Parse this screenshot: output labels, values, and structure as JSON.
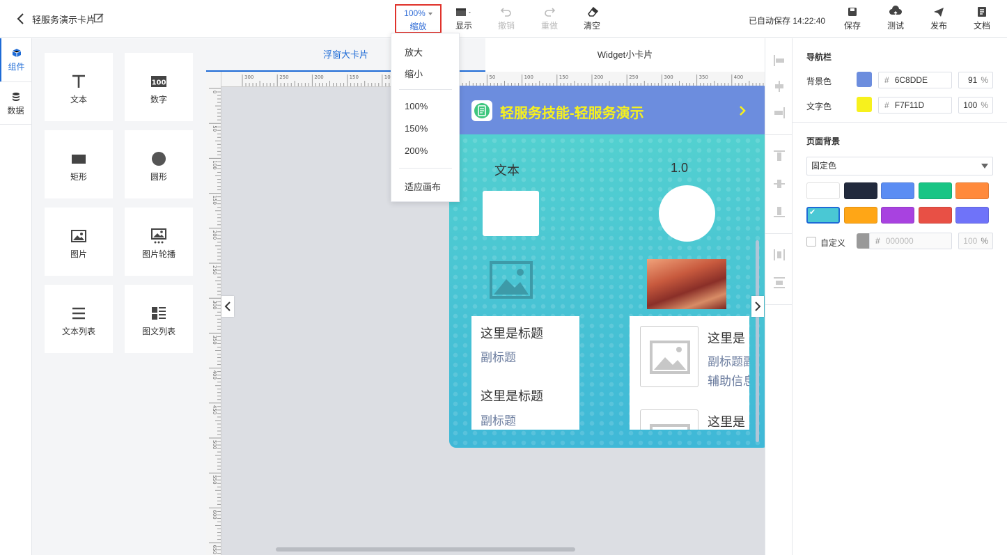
{
  "header": {
    "title": "轻服务演示卡片",
    "zoom": {
      "value": "100%",
      "label": "缩放"
    },
    "tools": {
      "display": "显示",
      "undo": "撤销",
      "redo": "重做",
      "clear": "清空"
    },
    "autosave": "已自动保存 14:22:40",
    "actions": {
      "save": "保存",
      "test": "测试",
      "publish": "发布",
      "docs": "文档"
    }
  },
  "rail": {
    "components": "组件",
    "data": "数据"
  },
  "palette": {
    "items": [
      {
        "label": "文本",
        "icon": "text-icon"
      },
      {
        "label": "数字",
        "icon": "number-icon"
      },
      {
        "label": "矩形",
        "icon": "rectangle-icon"
      },
      {
        "label": "圆形",
        "icon": "circle-icon"
      },
      {
        "label": "图片",
        "icon": "image-icon"
      },
      {
        "label": "图片轮播",
        "icon": "carousel-icon"
      },
      {
        "label": "文本列表",
        "icon": "text-list-icon"
      },
      {
        "label": "图文列表",
        "icon": "image-text-list-icon"
      }
    ]
  },
  "canvas": {
    "tabs": [
      {
        "label": "浮窗大卡片",
        "active": true
      },
      {
        "label": "Widget小卡片",
        "active": false
      }
    ],
    "ruler_h": [
      "300",
      "250",
      "200",
      "150",
      "100",
      "50",
      "0",
      "50",
      "100",
      "150",
      "200",
      "250",
      "300",
      "350",
      "400",
      "450"
    ],
    "ruler_v": [
      "0",
      "50",
      "100",
      "150",
      "200",
      "250",
      "300",
      "350",
      "400",
      "450",
      "500",
      "550",
      "600",
      "650"
    ]
  },
  "card": {
    "title": "轻服务技能-轻服务演示",
    "text": "文本",
    "number": "1.0",
    "list": [
      {
        "title": "这里是标题",
        "subtitle": "副标题"
      },
      {
        "title": "这里是标题",
        "subtitle": "副标题"
      }
    ],
    "rich": [
      {
        "title": "这里是",
        "subtitle": "副标题副",
        "aux": "辅助信息"
      },
      {
        "title": "这里是"
      }
    ]
  },
  "zoom_menu": {
    "items": [
      "放大",
      "缩小",
      "100%",
      "150%",
      "200%",
      "适应画布"
    ]
  },
  "props": {
    "navbar": {
      "title": "导航栏",
      "bg_label": "背景色",
      "bg_color": "6C8DDE",
      "bg_opacity": "91",
      "text_label": "文字色",
      "text_color": "F7F11D",
      "text_opacity": "100",
      "pct_unit": "%",
      "hash": "#"
    },
    "page_bg": {
      "title": "页面背景",
      "mode": "固定色",
      "presets": [
        "#ffffff",
        "#222a3d",
        "#5b8df3",
        "#19c585",
        "#ff8a3c",
        "#4ac8d4",
        "#ffa616",
        "#a842e0",
        "#e85045",
        "#6f73f9"
      ],
      "custom_label": "自定义",
      "custom_color": "000000",
      "custom_opacity": "100"
    }
  }
}
